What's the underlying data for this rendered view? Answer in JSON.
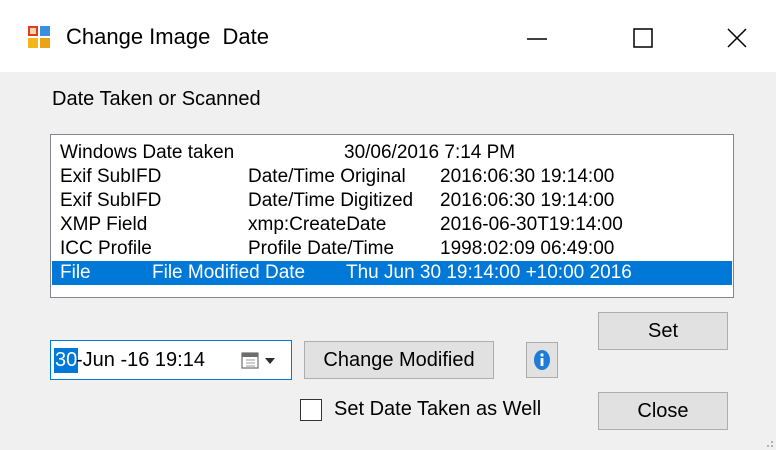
{
  "window": {
    "title": "Change Image  Date",
    "minimize_glyph": "—",
    "maximize_glyph": "☐",
    "close_glyph": "✕"
  },
  "section_label": "Date Taken or Scanned",
  "list": {
    "rows": [
      {
        "col1": "Windows Date taken",
        "col2": "",
        "col3": "30/06/2016 7:14 PM"
      },
      {
        "col1": "Exif SubIFD",
        "col2": "Date/Time Original",
        "col3": "2016:06:30 19:14:00"
      },
      {
        "col1": "Exif SubIFD",
        "col2": "Date/Time Digitized",
        "col3": "2016:06:30 19:14:00"
      },
      {
        "col1": "XMP Field",
        "col2": "xmp:CreateDate",
        "col3": "2016-06-30T19:14:00"
      },
      {
        "col1": "ICC Profile",
        "col2": "Profile Date/Time",
        "col3": "1998:02:09 06:49:00"
      },
      {
        "col1": "File",
        "col2": "File Modified Date",
        "col3": "Thu Jun 30 19:14:00 +10:00 2016"
      }
    ],
    "selected_index": 5
  },
  "date_picker": {
    "selected_part": "30",
    "rest": "-Jun -16 19:14"
  },
  "buttons": {
    "set": "Set",
    "change_modified": "Change Modified",
    "close": "Close",
    "info": "i"
  },
  "checkbox": {
    "label": "Set Date Taken as Well",
    "checked": false
  },
  "colors": {
    "selection": "#0078d7",
    "button_face": "#e1e1e1",
    "window_bg": "#f0f0f0",
    "info_icon": "#1e7bd8"
  },
  "icons": {
    "app": "image-date-app-icon",
    "calendar": "calendar-icon",
    "info": "info-icon"
  }
}
